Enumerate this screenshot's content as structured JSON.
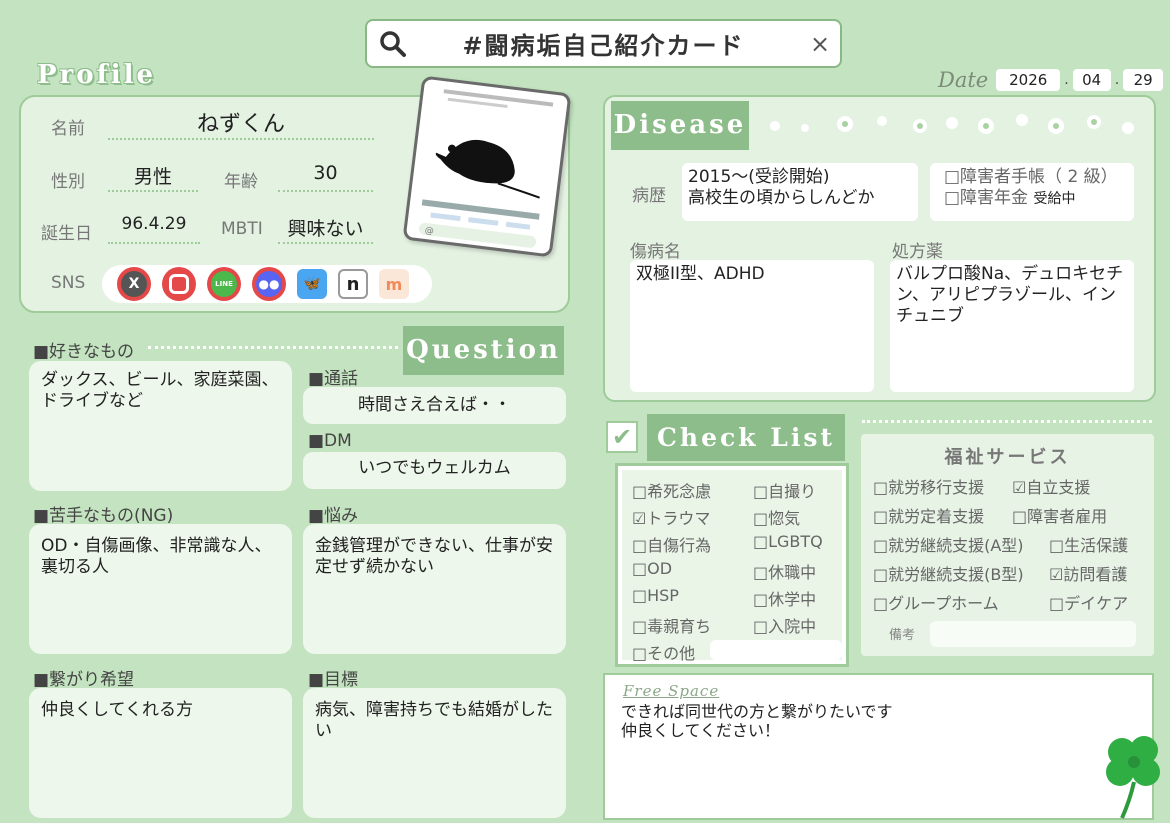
{
  "search": {
    "title": "#闘病垢自己紹介カード",
    "close": "×"
  },
  "date": {
    "label": "Date",
    "year": "2026",
    "month": "04",
    "day": "29",
    "sep": "."
  },
  "profile": {
    "heading": "Profile",
    "name_label": "名前",
    "name_value": "ねずくん",
    "gender_label": "性別",
    "gender_value": "男性",
    "age_label": "年齢",
    "age_value": "30",
    "birthday_label": "誕生日",
    "birthday_value": "96.4.29",
    "mbti_label": "MBTI",
    "mbti_value": "興味ない",
    "sns_label": "SNS",
    "sns_icons": [
      {
        "name": "x",
        "glyph": "𝕏",
        "color": "#555555"
      },
      {
        "name": "instagram",
        "glyph": "◎",
        "color": "#e0405e"
      },
      {
        "name": "line",
        "glyph": "LINE",
        "color": "#4cb84c"
      },
      {
        "name": "discord",
        "glyph": "◉",
        "color": "#5865f2"
      },
      {
        "name": "bluesky",
        "glyph": "🦋",
        "color": "#4aa6f0"
      },
      {
        "name": "note",
        "glyph": "n",
        "color": "#222222"
      },
      {
        "name": "misskey",
        "glyph": "m",
        "color": "#f2a35a"
      }
    ]
  },
  "question": {
    "heading": "Question",
    "likes_label": "■好きなもの",
    "likes_text": "ダックス、ビール、家庭菜園、ドライブなど",
    "call_label": "■通話",
    "call_text": "時間さえ合えば・・",
    "dm_label": "■DM",
    "dm_text": "いつでもウェルカム",
    "dislikes_label": "■苦手なもの(NG)",
    "dislikes_text": "OD・自傷画像、非常識な人、裏切る人",
    "worry_label": "■悩み",
    "worry_text": "金銭管理ができない、仕事が安定せず続かない",
    "connect_label": "■繋がり希望",
    "connect_text": "仲良くしてくれる方",
    "goal_label": "■目標",
    "goal_text": "病気、障害持ちでも結婚がしたい"
  },
  "disease": {
    "heading": "Disease",
    "history_label": "病歴",
    "history_line1": "2015～(受診開始)",
    "history_line2": "高校生の頃からしんどか",
    "handbook_text": "□障害者手帳（ 2 級）",
    "pension_text": "□障害年金",
    "pension_status": "受給中",
    "diagnosis_label": "傷病名",
    "diagnosis_text": "双極II型、ADHD",
    "meds_label": "処方薬",
    "meds_text": "バルプロ酸Na、デュロキセチン、アリピプラゾール、インチュニブ"
  },
  "checklist": {
    "heading": "Check List",
    "check_mark": "✔",
    "left": [
      "□希死念慮",
      "☑トラウマ",
      "□自傷行為",
      "□OD",
      "□HSP",
      "□毒親育ち",
      "□その他"
    ],
    "right": [
      "□自撮り",
      "□惚気",
      "□LGBTQ",
      "□休職中",
      "□休学中",
      "□入院中"
    ]
  },
  "welfare": {
    "title": "福祉サービス",
    "left": [
      "□就労移行支援",
      "□就労定着支援",
      "□就労継続支援(A型)",
      "□就労継続支援(B型)",
      "□グループホーム"
    ],
    "right": [
      "☑自立支援",
      "□障害者雇用",
      "□生活保護",
      "☑訪問看護",
      "□デイケア"
    ],
    "notes_label": "備考"
  },
  "free": {
    "title": "Free Space",
    "line1": "できれば同世代の方と繋がりたいです",
    "line2": "仲良くしてください！"
  }
}
